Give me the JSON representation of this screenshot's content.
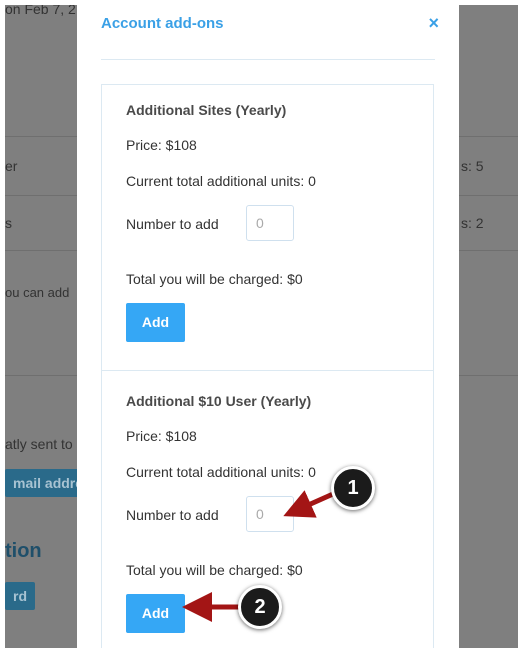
{
  "background": {
    "date_fragment": "on Feb 7, 2",
    "row1_left": "er",
    "row1_right": "s: 5",
    "row2_left": "s",
    "row2_right": "s: 2",
    "note": "ou can add",
    "sent_text": "atly sent to",
    "email_button": "mail addre",
    "section_heading": "tion",
    "small_button": "rd"
  },
  "modal": {
    "title": "Account add-ons",
    "close_symbol": "×",
    "addons": [
      {
        "title": "Additional Sites (Yearly)",
        "price": "Price: $108",
        "current_units": "Current total additional units: 0",
        "number_label": "Number to add",
        "number_placeholder": "0",
        "total": "Total you will be charged: $0",
        "button": "Add"
      },
      {
        "title": "Additional $10 User (Yearly)",
        "price": "Price: $108",
        "current_units": "Current total additional units: 0",
        "number_label": "Number to add",
        "number_placeholder": "0",
        "total": "Total you will be charged: $0",
        "button": "Add"
      }
    ]
  },
  "annotations": {
    "callout_1": "1",
    "callout_2": "2",
    "arrow_color": "#a31515"
  },
  "colors": {
    "accent": "#3aa0e6",
    "button": "#35a7f5"
  }
}
